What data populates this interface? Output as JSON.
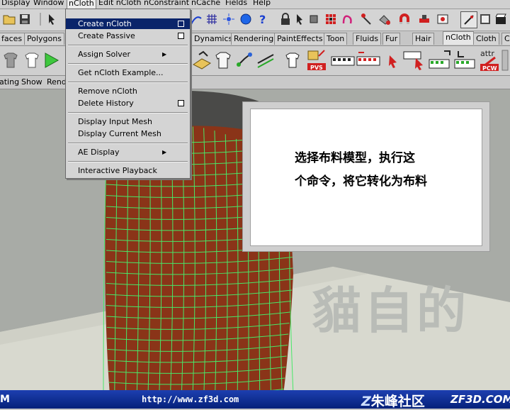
{
  "menubar": {
    "items": [
      "Display",
      "Window",
      "nCloth",
      "Edit nCloth",
      "nConstraint",
      "nCache",
      "Fields",
      "Help"
    ]
  },
  "shelf": {
    "tabs": [
      "faces",
      "Polygons",
      "Dynamics",
      "Rendering",
      "PaintEffects",
      "Toon",
      "Fluids",
      "Fur",
      "Hair",
      "nCloth",
      "Cloth",
      "C"
    ],
    "active_tab": "nCloth",
    "icon_labels": {
      "pvs": "PVS",
      "attr": "attr",
      "pcw": "PCW"
    }
  },
  "panel_menu": {
    "items": [
      "ating",
      "Show",
      "Rend"
    ]
  },
  "dropdown": {
    "items": [
      {
        "label": "Create nCloth",
        "highlighted": true,
        "option_box": true
      },
      {
        "label": "Create Passive",
        "option_box": true
      },
      {
        "label": "Assign Solver",
        "submenu": true
      },
      {
        "label": "Get nCloth Example..."
      },
      {
        "label": "Remove nCloth"
      },
      {
        "label": "Delete History",
        "option_box": true
      },
      {
        "label": "Display Input Mesh"
      },
      {
        "label": "Display Current Mesh"
      },
      {
        "label": "AE Display",
        "submenu": true
      },
      {
        "label": "Interactive Playback"
      }
    ]
  },
  "annotation": {
    "line1": "选择布料模型，执行这",
    "line2": "个命令，将它转化为布料"
  },
  "watermark": "貓自的",
  "footer": {
    "left_mark": "M",
    "url": "http://www.zf3d.com",
    "brand_cn": "朱峰社区",
    "brand_logo": "Z",
    "brand_en": "ZF3D.COM"
  },
  "colors": {
    "highlight": "#0a246a",
    "mesh_fill": "#8a3418",
    "mesh_wire": "#48e868",
    "footer_bg": "#05217a"
  }
}
